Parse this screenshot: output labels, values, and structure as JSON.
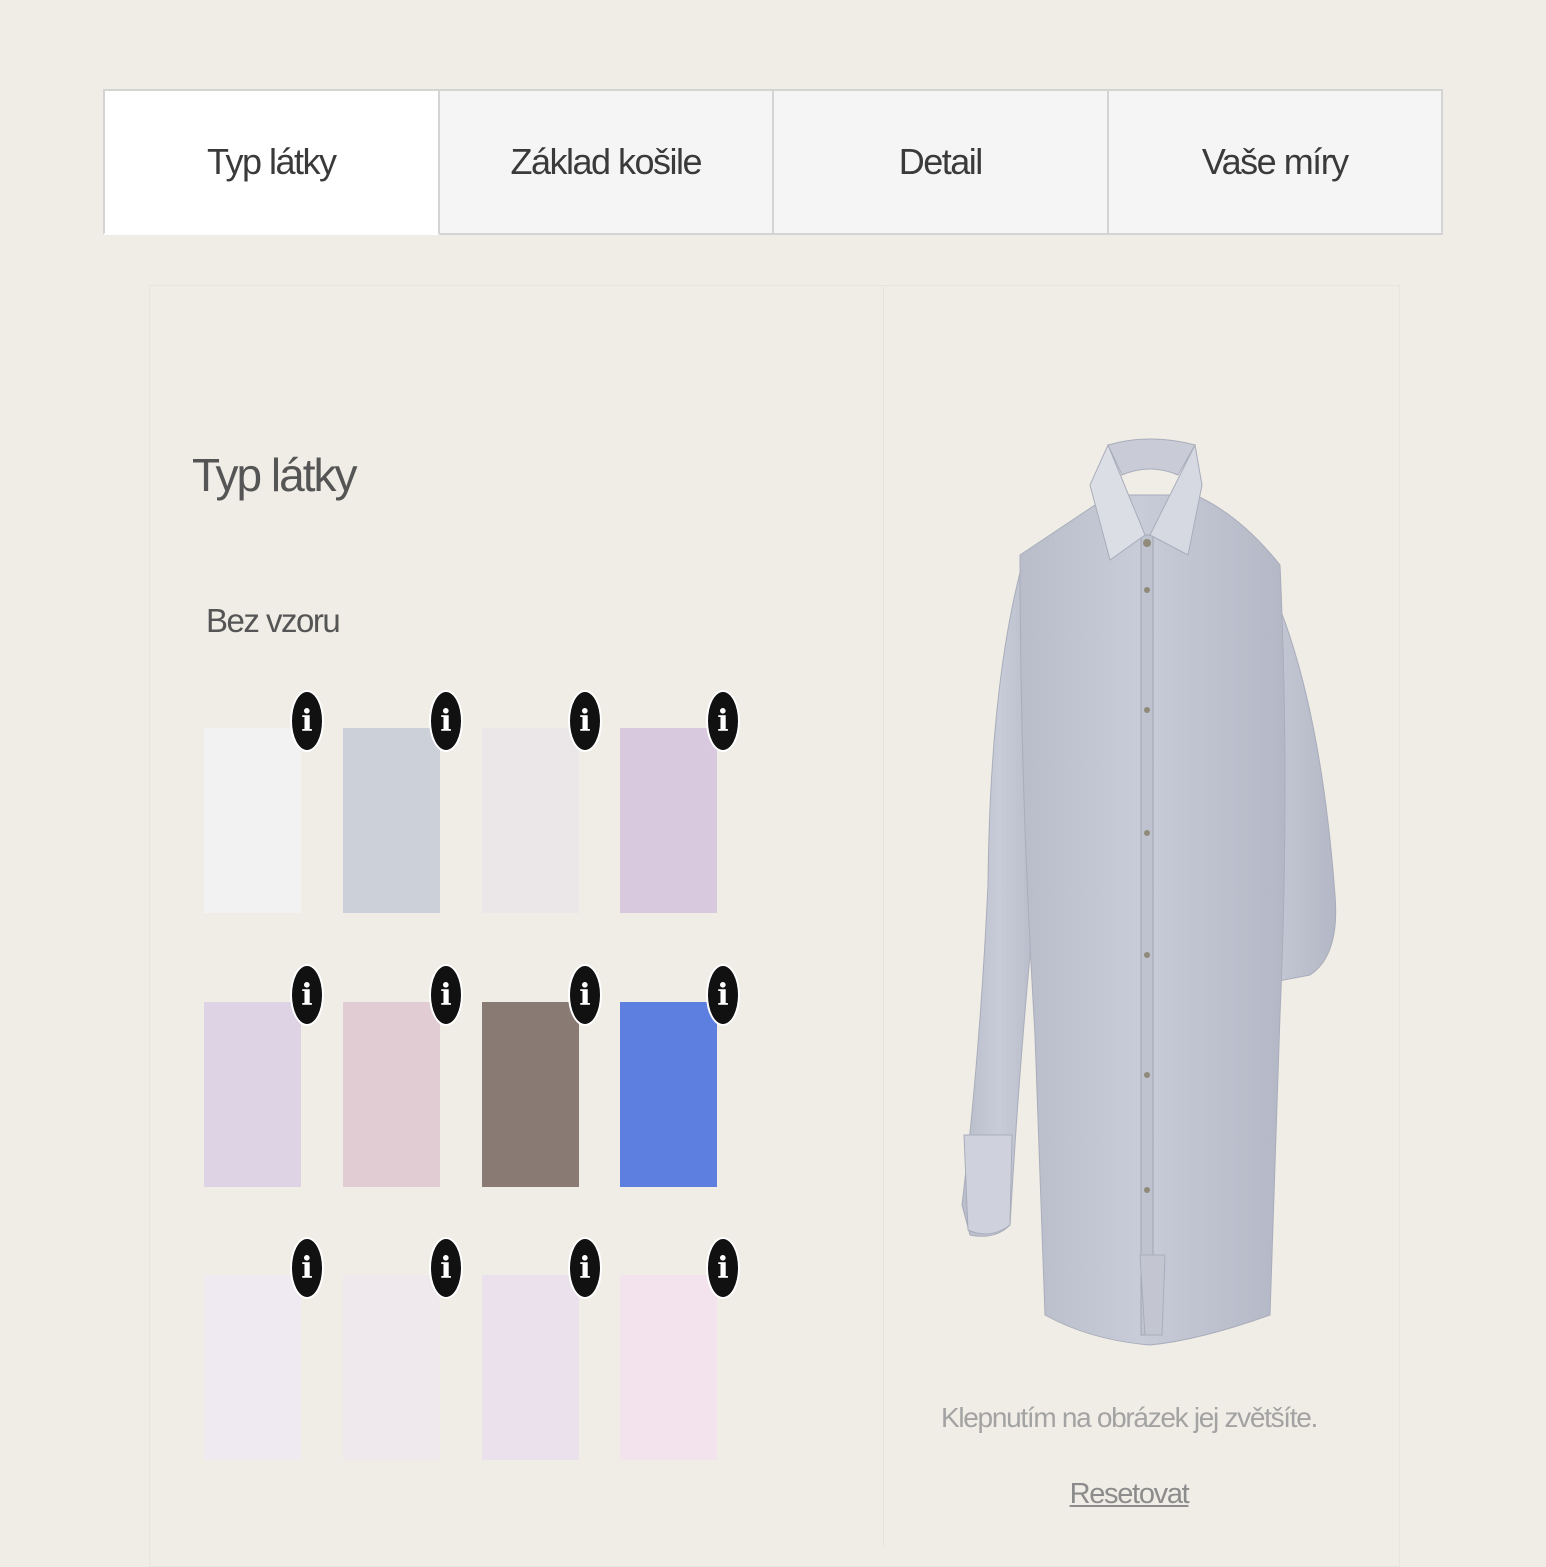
{
  "tabs": [
    {
      "label": "Typ látky",
      "active": true
    },
    {
      "label": "Základ košile",
      "active": false
    },
    {
      "label": "Detail",
      "active": false
    },
    {
      "label": "Vaše míry",
      "active": false
    }
  ],
  "section": {
    "title": "Typ látky",
    "subtitle": "Bez vzoru"
  },
  "info_glyph": "i",
  "fabrics": [
    {
      "color": "#f3f2f2"
    },
    {
      "color": "#ccd0d9"
    },
    {
      "color": "#ebe7e9"
    },
    {
      "color": "#d9c9df"
    },
    {
      "color": "#ddd3e5"
    },
    {
      "color": "#e2ccd4"
    },
    {
      "color": "#8a7a74"
    },
    {
      "color": "#5d7fe0"
    },
    {
      "color": "#efeaf1"
    },
    {
      "color": "#efe9ee"
    },
    {
      "color": "#ebe1ec"
    },
    {
      "color": "#f2e3ec"
    }
  ],
  "preview": {
    "shirt_color": "#c8ccd8",
    "caption": "Klepnutím na obrázek jej zvětšíte.",
    "reset_label": "Resetovat"
  }
}
